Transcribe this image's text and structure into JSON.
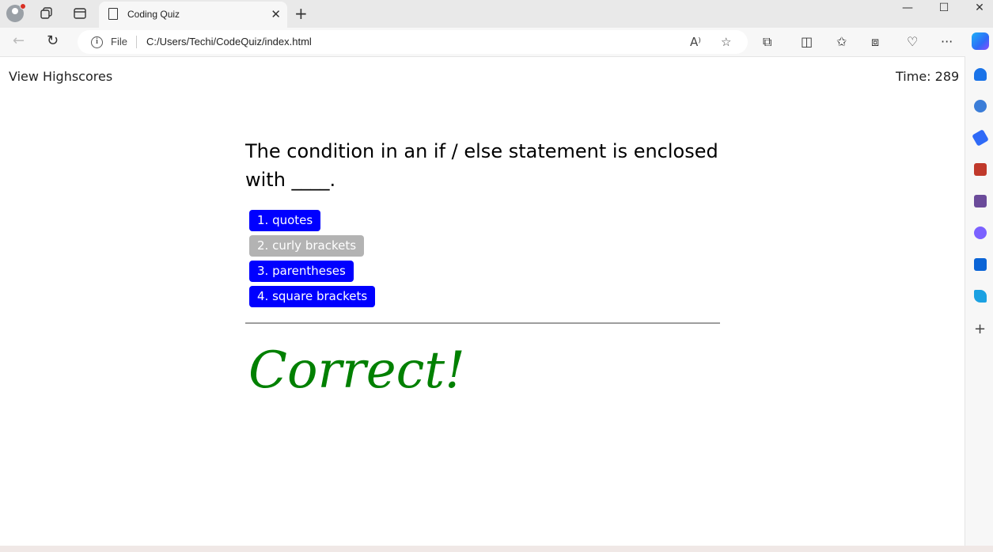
{
  "browser": {
    "tab_title": "Coding Quiz",
    "tab_close": "✕",
    "new_tab": "+",
    "address": {
      "info_glyph": "i",
      "scheme_label": "File",
      "url": "C:/Users/Techi/CodeQuiz/index.html"
    },
    "window_controls": {
      "minimize": "—",
      "maximize": "☐",
      "close": "✕"
    },
    "icons": {
      "read_aloud": "A⁾",
      "favorite": "☆",
      "extensions": "⧉",
      "split_screen": "◫",
      "favorites": "✩",
      "collections": "⧈",
      "performance": "♡",
      "more": "···",
      "back": "←",
      "refresh": "↻"
    },
    "sidebar_add": "+",
    "colors": {
      "sidebar_notifications": "#1a73e8",
      "sidebar_search": "#3b7dd8",
      "sidebar_shopping": "#2f6af7",
      "sidebar_tools": "#c0392b",
      "sidebar_games": "#6b4b9a",
      "sidebar_m365": "#7b61ff",
      "sidebar_outlook": "#0a64d6",
      "sidebar_drop": "#1ba1e2"
    }
  },
  "page": {
    "view_highscores": "View Highscores",
    "timer": "Time: 289",
    "question": "The condition in an if / else statement is enclosed with ____.",
    "choices": [
      {
        "label": "1. quotes",
        "selected": false
      },
      {
        "label": "2. curly brackets",
        "selected": true
      },
      {
        "label": "3. parentheses",
        "selected": false
      },
      {
        "label": "4. square brackets",
        "selected": false
      }
    ],
    "feedback": "Correct!",
    "colors": {
      "choice_bg": "#0000ff",
      "choice_selected_bg": "#b3b3b3",
      "feedback_text": "#008000"
    }
  }
}
